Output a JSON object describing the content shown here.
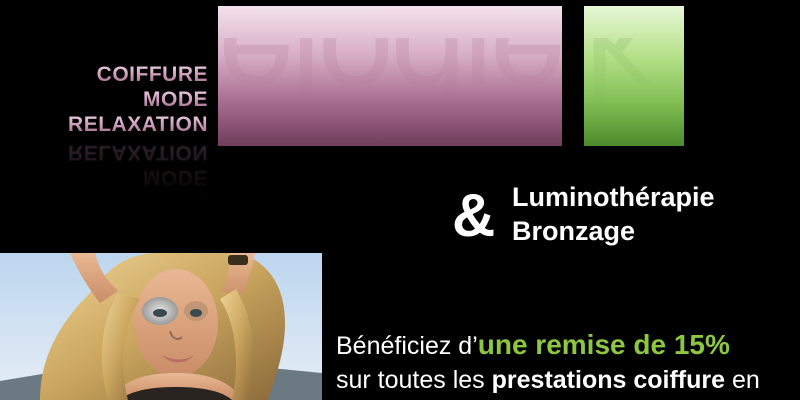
{
  "tagline": [
    "COIFFURE",
    "MODE",
    "RELAXATION"
  ],
  "logo": {
    "main": "élodie",
    "accent": "k."
  },
  "services": {
    "ampersand": "&",
    "items": [
      "Luminothérapie",
      "Bronzage"
    ]
  },
  "offer": {
    "line1_prefix": "Bénéficiez d’",
    "line1_highlight": "une remise de 15%",
    "line2_prefix": "sur toutes les ",
    "line2_bold": "prestations coiffure",
    "line2_suffix": " en"
  },
  "colors": {
    "background": "#000000",
    "logo_pink": "#c998b6",
    "logo_green": "#8dc63f",
    "highlight_green": "#8dc63f",
    "text": "#ffffff"
  },
  "photo": {
    "subject": "woman-portrait-photo"
  }
}
